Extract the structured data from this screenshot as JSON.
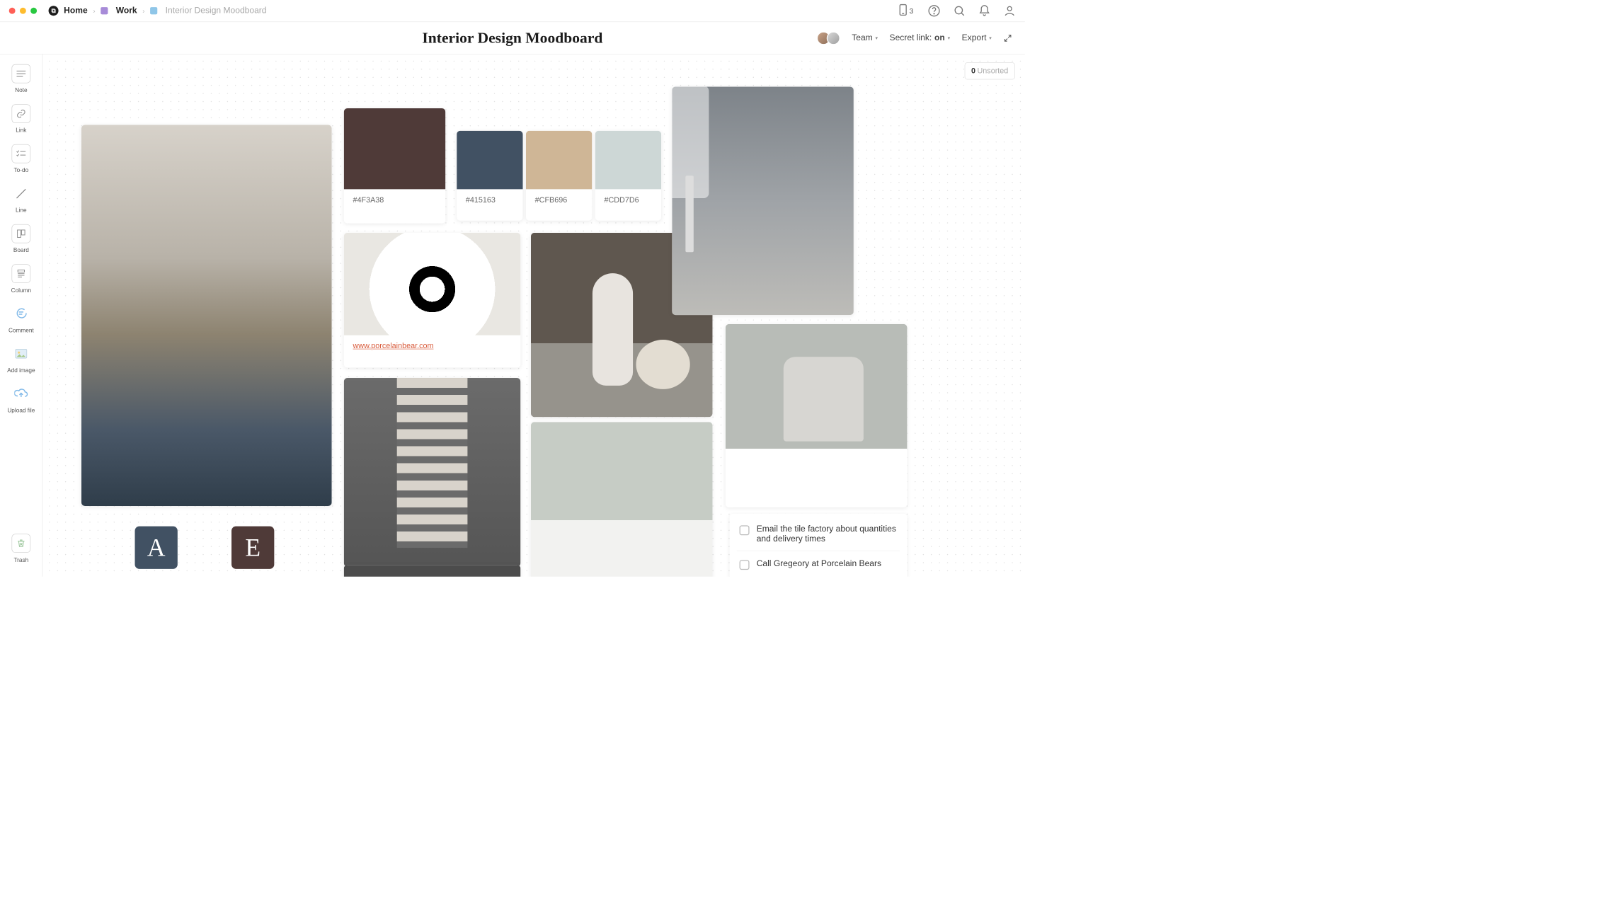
{
  "breadcrumb": {
    "home": "Home",
    "work": "Work",
    "workColor": "#a78bd8",
    "current": "Interior Design Moodboard",
    "currentColor": "#8fc6e8"
  },
  "devices_count": "3",
  "page_title": "Interior Design Moodboard",
  "subbar": {
    "team": "Team",
    "secret_prefix": "Secret link:",
    "secret_state": "on",
    "export": "Export"
  },
  "unsorted": {
    "count": "0",
    "label": "Unsorted"
  },
  "sidebar": {
    "note": "Note",
    "link": "Link",
    "todo": "To-do",
    "line": "Line",
    "board": "Board",
    "column": "Column",
    "comment": "Comment",
    "addimage": "Add image",
    "upload": "Upload file",
    "trash": "Trash"
  },
  "swatches": [
    {
      "hex": "#4F3A38",
      "label": "#4F3A38"
    },
    {
      "hex": "#415163",
      "label": "#415163"
    },
    {
      "hex": "#CFB696",
      "label": "#CFB696"
    },
    {
      "hex": "#CDD7D6",
      "label": "#CDD7D6"
    }
  ],
  "link_card": {
    "url": "www.porcelainbear.com"
  },
  "tiles": {
    "a": {
      "letter": "A",
      "bg": "#415163"
    },
    "e": {
      "letter": "E",
      "bg": "#4F3A38"
    }
  },
  "todos": [
    "Email the tile factory about quantities and delivery times",
    "Call Gregeory at Porcelain Bears"
  ]
}
